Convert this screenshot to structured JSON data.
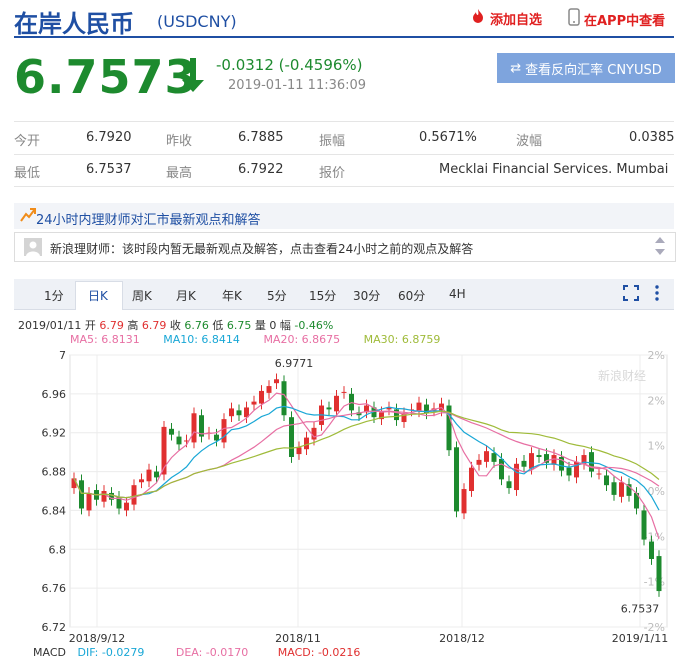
{
  "header": {
    "title": "在岸人民币",
    "symbol": "(USDCNY)",
    "add_favorite": "添加自选",
    "view_in_app": "在APP中查看"
  },
  "quote": {
    "price": "6.7573",
    "change": "-0.0312 (-0.4596%)",
    "datetime": "2019-01-11 11:36:09",
    "reverse_button": "查看反向汇率 CNYUSD",
    "direction": "down",
    "color_down": "#1d8a2e",
    "color_up": "#e03030"
  },
  "stats": {
    "open_label": "今开",
    "open": "6.7920",
    "prev_close_label": "昨收",
    "prev_close": "6.7885",
    "amplitude_label": "振幅",
    "amplitude": "0.5671%",
    "volatility_label": "波幅",
    "volatility": "0.0385",
    "low_label": "最低",
    "low": "6.7537",
    "high_label": "最高",
    "high": "6.7922",
    "quote_source_label": "报价",
    "quote_source": "Mecklai Financial Services. Mumbai"
  },
  "opinion": {
    "title": "24小时内理财师对汇市最新观点和解答",
    "message": "新浪理财师：该时段内暂无最新观点及解答，点击查看24小时之前的观点及解答"
  },
  "tabs": [
    "1分",
    "日K",
    "周K",
    "月K",
    "年K",
    "5分",
    "15分",
    "30分",
    "60分",
    "4H"
  ],
  "active_tab": "日K",
  "ohlc_line": {
    "date": "2019/01/11",
    "open_label": "开",
    "open": "6.79",
    "high_label": "高",
    "high": "6.79",
    "close_label": "收",
    "close": "6.76",
    "low_label": "低",
    "low": "6.75",
    "volume_label": "量",
    "volume": "0",
    "range_label": "幅",
    "range": "-0.46%"
  },
  "ma": {
    "ma5": "MA5: 6.8131",
    "ma10": "MA10: 6.8414",
    "ma20": "MA20: 6.8675",
    "ma30": "MA30: 6.8759",
    "ma5_color": "#e76fa3",
    "ma10_color": "#19a7d6",
    "ma20_color": "#e76fa3",
    "ma30_color": "#9fbb3a"
  },
  "macd": {
    "label": "MACD",
    "dif": "DIF: -0.0279",
    "dea": "DEA: -0.0170",
    "macd": "MACD: -0.0216"
  },
  "watermark": "新浪财经",
  "chart_data": {
    "type": "candlestick",
    "y_ticks": [
      "7",
      "6.96",
      "6.92",
      "6.88",
      "6.84",
      "6.8",
      "6.76",
      "6.72"
    ],
    "ylim": [
      6.72,
      7.0
    ],
    "right_ticks": [
      "2%",
      "2%",
      "1%",
      "0%",
      "-1%",
      "-1%",
      "-2%"
    ],
    "x_labels": [
      "2018/9/12",
      "2018/11",
      "2018/12",
      "2019/1/11"
    ],
    "max_label": "6.9771",
    "min_label": "6.7537",
    "close": [
      6.873,
      6.842,
      6.858,
      6.851,
      6.86,
      6.851,
      6.842,
      6.848,
      6.866,
      6.872,
      6.882,
      6.874,
      6.926,
      6.918,
      6.908,
      6.912,
      6.94,
      6.916,
      6.92,
      6.912,
      6.934,
      6.945,
      6.938,
      6.946,
      6.952,
      6.963,
      6.968,
      6.975,
      6.938,
      6.895,
      6.905,
      6.915,
      6.925,
      6.948,
      6.944,
      6.958,
      6.962,
      6.943,
      6.938,
      6.948,
      6.936,
      6.941,
      6.946,
      6.933,
      6.94,
      6.944,
      6.951,
      6.94,
      6.945,
      6.95,
      6.902,
      6.839,
      6.862,
      6.884,
      6.892,
      6.901,
      6.89,
      6.872,
      6.863,
      6.888,
      6.885,
      6.899,
      6.895,
      6.889,
      6.897,
      6.881,
      6.876,
      6.89,
      6.897,
      6.88,
      6.878,
      6.866,
      6.856,
      6.869,
      6.855,
      6.842,
      6.81,
      6.79,
      6.757
    ]
  }
}
